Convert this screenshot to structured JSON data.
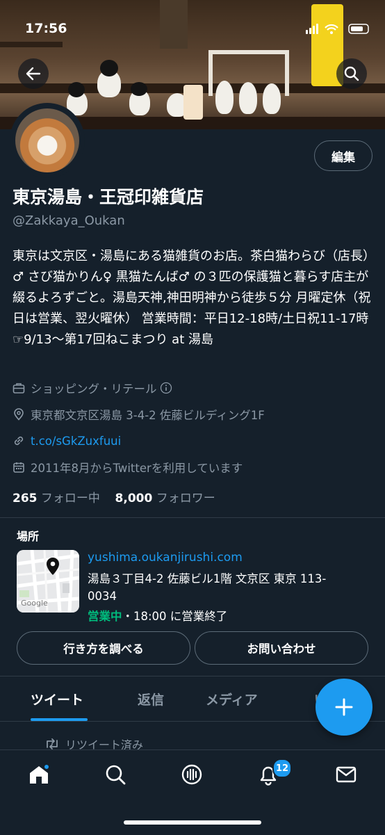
{
  "status_bar": {
    "time": "17:56"
  },
  "profile": {
    "display_name": "東京湯島・王冠印雑貨店",
    "handle": "@Zakkaya_Oukan",
    "edit_label": "編集",
    "bio": "東京は文京区・湯島にある猫雑貨のお店。茶白猫わらび（店長）♂ さび猫かりん♀ 黒猫たんば♂ の３匹の保護猫と暮らす店主が綴るよろずごと。湯島天神,神田明神から徒歩５分 月曜定休（祝日は営業、翌火曜休） 営業時間：平日12-18時/土日祝11-17時 ☞9/13～第17回ねこまつり at 湯島",
    "category": "ショッピング・リテール",
    "location": "東京都文京区湯島 3-4-2 佐藤ビルディング1F",
    "link": "t.co/sGkZuxfuui",
    "joined": "2011年8月からTwitterを利用しています",
    "following_count": "265",
    "following_label": "フォロー中",
    "followers_count": "8,000",
    "followers_label": "フォロワー"
  },
  "location_card": {
    "heading": "場所",
    "url": "yushima.oukanjirushi.com",
    "address": "湯島３丁目4-2 佐藤ビル1階 文京区 東京 113-0034",
    "open_status": "営業中",
    "hours_text": "・18:00 に営業終了",
    "directions_button": "行き方を調べる",
    "contact_button": "お問い合わせ",
    "map_label": "Google"
  },
  "tabs": [
    "ツイート",
    "返信",
    "メディア",
    "い"
  ],
  "timeline": {
    "retweet_label": "リツイート済み"
  },
  "nav": {
    "notifications_badge": "12"
  },
  "icons": [
    "back-arrow-icon",
    "search-icon",
    "briefcase-icon",
    "info-icon",
    "location-pin-icon",
    "link-icon",
    "calendar-icon",
    "retweet-icon",
    "home-icon",
    "spaces-icon",
    "bell-icon",
    "mail-icon",
    "plus-icon"
  ],
  "colors": {
    "background": "#15202b",
    "accent": "#1d9bf0",
    "muted": "#8b98a5",
    "open_green": "#00ba7c"
  }
}
